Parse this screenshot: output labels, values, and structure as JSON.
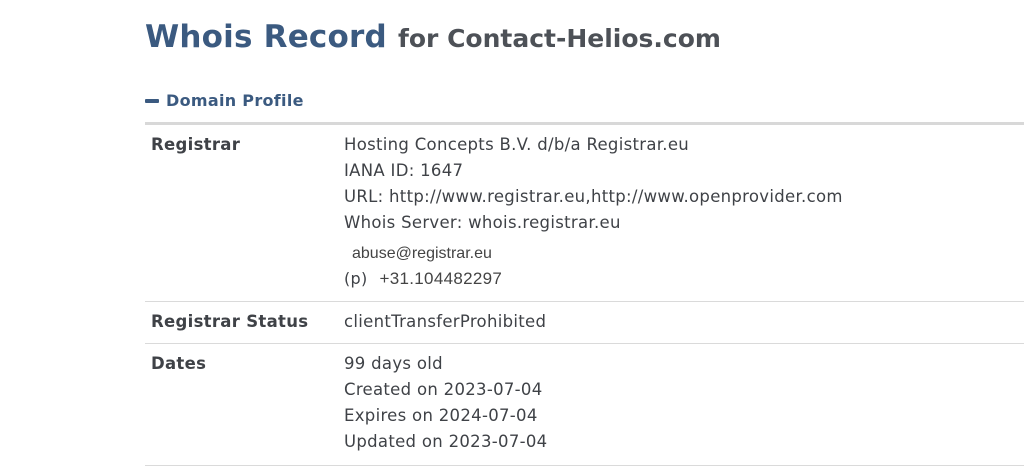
{
  "header": {
    "title_main": "Whois Record",
    "title_sub": "for Contact-Helios.com"
  },
  "section": {
    "label": "Domain Profile",
    "toggle_icon": "minus-icon"
  },
  "rows": {
    "registrar": {
      "label": "Registrar",
      "name": "Hosting Concepts B.V. d/b/a Registrar.eu",
      "iana": "IANA ID: 1647",
      "url": "URL: http://www.registrar.eu,http://www.openprovider.com",
      "whois_server": "Whois Server: whois.registrar.eu",
      "email": "abuse@registrar.eu",
      "phone_prefix": "(p)",
      "phone": "+31.104482297"
    },
    "status": {
      "label": "Registrar Status",
      "value": "clientTransferProhibited"
    },
    "dates": {
      "label": "Dates",
      "age": "99 days old",
      "created": "Created on 2023-07-04",
      "expires": "Expires on 2024-07-04",
      "updated": "Updated on 2023-07-04"
    }
  },
  "colors": {
    "accent": "#3b5a80",
    "text": "#3f4247",
    "rule": "#dadada"
  }
}
